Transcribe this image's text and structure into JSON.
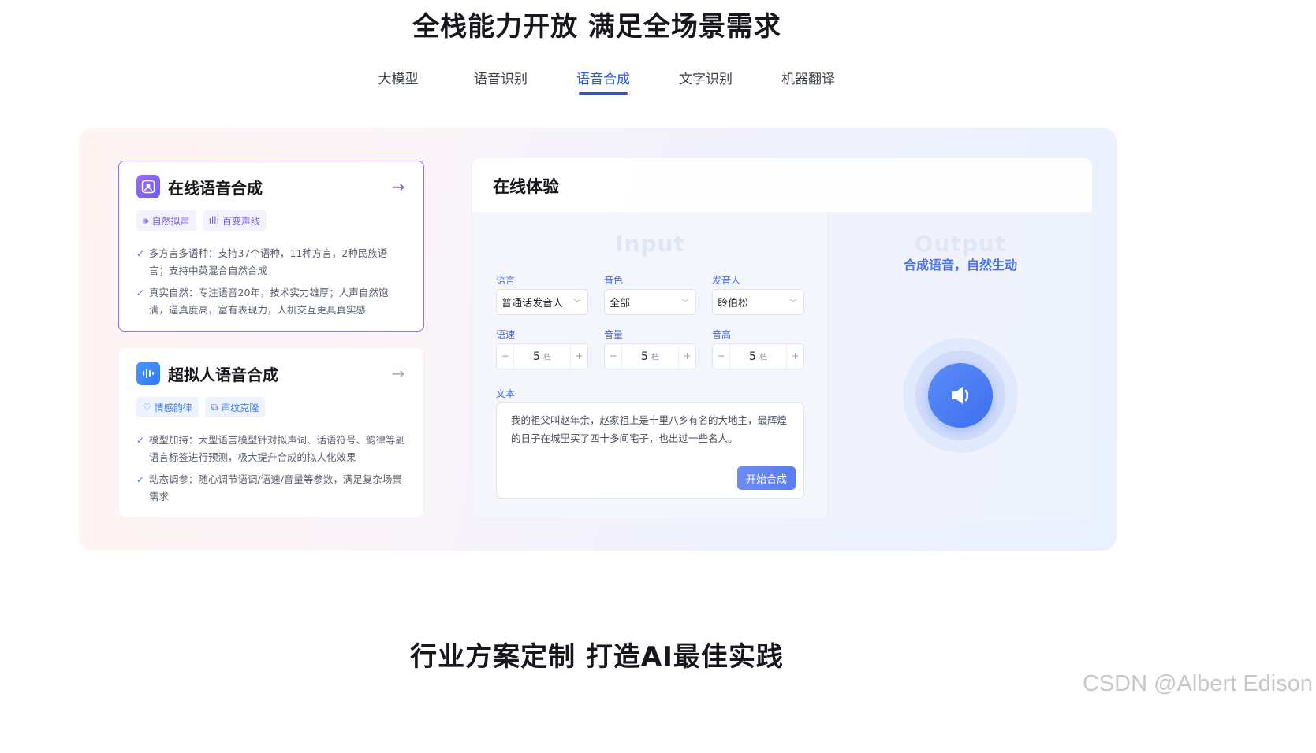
{
  "header": {
    "title": "全栈能力开放 满足全场景需求"
  },
  "tabs": [
    {
      "label": "大模型",
      "active": false
    },
    {
      "label": "语音识别",
      "active": false
    },
    {
      "label": "语音合成",
      "active": true
    },
    {
      "label": "文字识别",
      "active": false
    },
    {
      "label": "机器翻译",
      "active": false
    }
  ],
  "cards": [
    {
      "title": "在线语音合成",
      "icon": "voice-user-icon",
      "badges": [
        {
          "label": "自然拟声",
          "icon": "speaker-icon"
        },
        {
          "label": "百变声线",
          "icon": "waveform-icon"
        }
      ],
      "bullets": [
        "多方言多语种：支持37个语种，11种方言，2种民族语言；支持中英混合自然合成",
        "真实自然：专注语音20年，技术实力雄厚；人声自然饱满，逼真度高，富有表现力，人机交互更具真实感"
      ],
      "selected": true
    },
    {
      "title": "超拟人语音合成",
      "icon": "sound-bars-icon",
      "badges": [
        {
          "label": "情感韵律",
          "icon": "heart-icon"
        },
        {
          "label": "声纹克隆",
          "icon": "clone-icon"
        }
      ],
      "bullets": [
        "模型加持：大型语言模型针对拟声词、话语符号、韵律等副语言标签进行预测，极大提升合成的拟人化效果",
        "动态调参：随心调节语调/语速/音量等参数，满足复杂场景需求"
      ],
      "selected": false
    }
  ],
  "demo": {
    "title": "在线体验",
    "input": {
      "ghost_label": "Input",
      "language": {
        "label": "语言",
        "value": "普通话发音人"
      },
      "timbre": {
        "label": "音色",
        "value": "全部"
      },
      "speaker": {
        "label": "发音人",
        "value": "聆伯松"
      },
      "speed": {
        "label": "语速",
        "value": "5",
        "unit": "档",
        "minus": "−",
        "plus": "+"
      },
      "volume": {
        "label": "音量",
        "value": "5",
        "unit": "档",
        "minus": "−",
        "plus": "+"
      },
      "pitch": {
        "label": "音高",
        "value": "5",
        "unit": "档",
        "minus": "−",
        "plus": "+"
      },
      "text_label": "文本",
      "text_value": "我的祖父叫赵年余，赵家祖上是十里八乡有名的大地主，最辉煌的日子在城里买了四十多间宅子，也出过一些名人。",
      "start_button": "开始合成"
    },
    "output": {
      "ghost_label": "Output",
      "subtitle": "合成语音，自然生动",
      "play_icon": "speaker-icon"
    }
  },
  "footer": {
    "title": "行业方案定制 打造AI最佳实践"
  },
  "watermark": "CSDN @Albert Edison",
  "colors": {
    "accent": "#2a55e0",
    "purple": "#7560ea",
    "blue": "#3d7bf0"
  }
}
